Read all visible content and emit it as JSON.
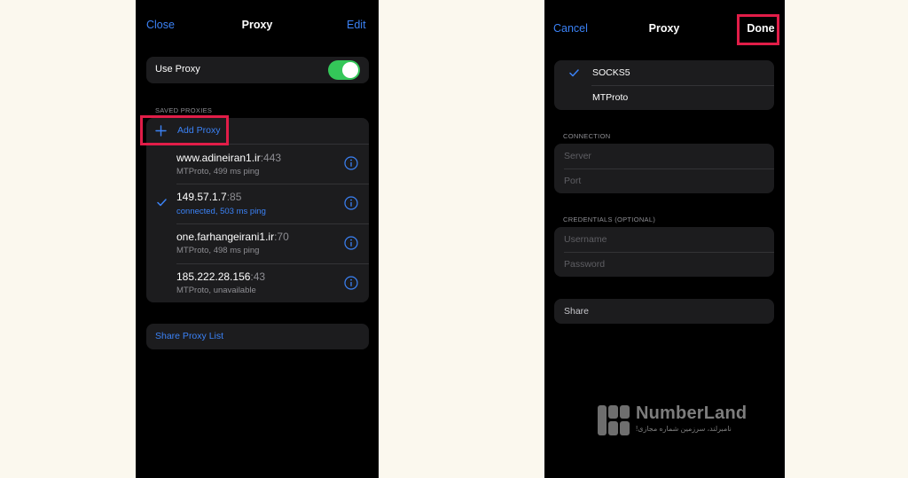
{
  "left": {
    "nav": {
      "close_label": "Close",
      "title": "Proxy",
      "edit_label": "Edit"
    },
    "use_proxy": {
      "label": "Use Proxy",
      "enabled": true
    },
    "saved_proxies": {
      "section_label": "SAVED PROXIES",
      "add_label": "Add Proxy",
      "items": [
        {
          "host": "www.adineiran1.ir",
          "port": ":443",
          "status": "MTProto, 499 ms ping",
          "selected": false,
          "connected": false
        },
        {
          "host": "149.57.1.7",
          "port": ":85",
          "status": "connected, 503 ms ping",
          "selected": true,
          "connected": true
        },
        {
          "host": "one.farhangeirani1.ir",
          "port": ":70",
          "status": "MTProto, 498 ms ping",
          "selected": false,
          "connected": false
        },
        {
          "host": "185.222.28.156",
          "port": ":43",
          "status": "MTProto, unavailable",
          "selected": false,
          "connected": false
        }
      ]
    },
    "share_list_label": "Share Proxy List"
  },
  "right": {
    "nav": {
      "cancel_label": "Cancel",
      "title": "Proxy",
      "done_label": "Done"
    },
    "types": [
      {
        "label": "SOCKS5",
        "selected": true
      },
      {
        "label": "MTProto",
        "selected": false
      }
    ],
    "connection": {
      "section_label": "CONNECTION",
      "server_placeholder": "Server",
      "port_placeholder": "Port"
    },
    "credentials": {
      "section_label": "CREDENTIALS (OPTIONAL)",
      "username_placeholder": "Username",
      "password_placeholder": "Password"
    },
    "share_label": "Share"
  },
  "watermark": {
    "name": "NumberLand",
    "tagline": "نامبرلند، سرزمین شماره مجازی!"
  },
  "colors": {
    "accent": "#3b82f6",
    "toggle_on": "#34c759",
    "highlight": "#e11d48",
    "background": "#000000",
    "cell": "#1c1c1e"
  }
}
